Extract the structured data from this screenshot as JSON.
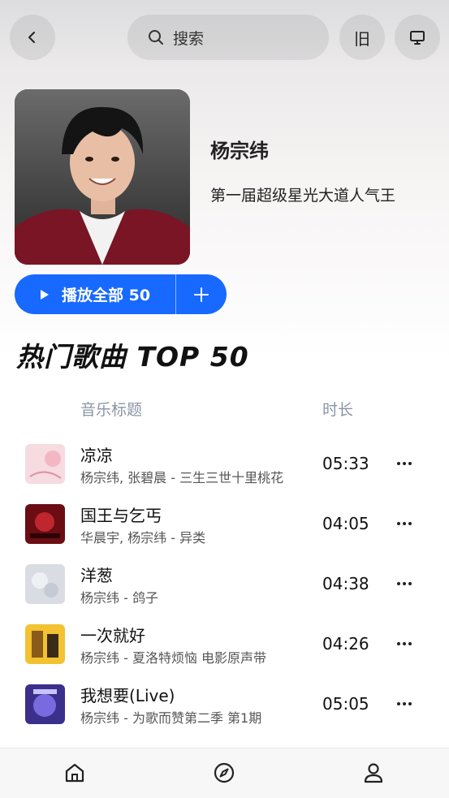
{
  "search": {
    "label": "搜索"
  },
  "header": {
    "history_glyph": "旧"
  },
  "artist": {
    "name": "杨宗纬",
    "description": "第一届超级星光大道人气王",
    "play_all_label": "播放全部 50"
  },
  "section": {
    "title": "热门歌曲 TOP 50"
  },
  "columns": {
    "title": "音乐标题",
    "duration": "时长"
  },
  "songs": [
    {
      "name": "凉凉",
      "sub": "杨宗纬, 张碧晨 - 三生三世十里桃花",
      "duration": "05:33"
    },
    {
      "name": "国王与乞丐",
      "sub": "华晨宇, 杨宗纬 - 异类",
      "duration": "04:05"
    },
    {
      "name": "洋葱",
      "sub": "杨宗纬 - 鸽子",
      "duration": "04:38"
    },
    {
      "name": "一次就好",
      "sub": "杨宗纬 - 夏洛特烦恼 电影原声带",
      "duration": "04:26"
    },
    {
      "name": "我想要(Live)",
      "sub": "杨宗纬 - 为歌而赞第二季 第1期",
      "duration": "05:05"
    }
  ],
  "colors": {
    "accent": "#1769ff"
  }
}
